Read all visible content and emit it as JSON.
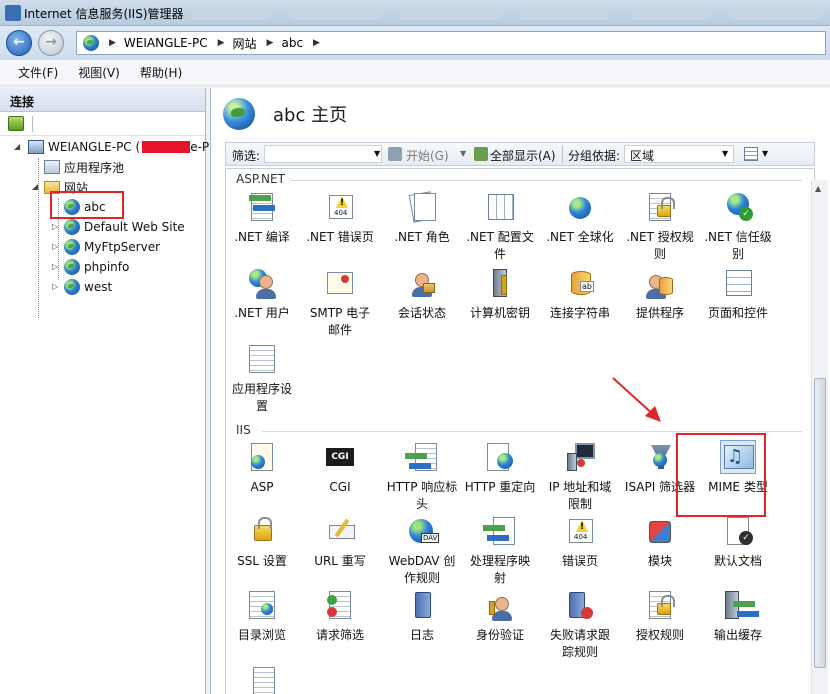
{
  "window": {
    "title": "Internet 信息服务(IIS)管理器"
  },
  "address": {
    "crumbs": [
      "WEIANGLE-PC",
      "网站",
      "abc"
    ]
  },
  "menu": {
    "items": [
      "文件(F)",
      "视图(V)",
      "帮助(H)"
    ]
  },
  "connections": {
    "header": "连接",
    "tree": {
      "root": "WEIANGLE-PC (",
      "root_suffix": "e-P",
      "app_pools": "应用程序池",
      "sites": "网站",
      "site_list": [
        "abc",
        "Default Web Site",
        "MyFtpServer",
        "phpinfo",
        "west"
      ]
    }
  },
  "page": {
    "title": "abc 主页",
    "filter": {
      "label": "筛选:",
      "go": "开始(G)",
      "show_all": "全部显示(A)",
      "group_by_label": "分组依据:",
      "group_by_value": "区域"
    }
  },
  "sections": {
    "aspnet": {
      "label": "ASP.NET",
      "tiles": [
        {
          "l1": ".NET 编译",
          "l2": ""
        },
        {
          "l1": ".NET 错误页",
          "l2": ""
        },
        {
          "l1": ".NET 角色",
          "l2": ""
        },
        {
          "l1": ".NET 配置文",
          "l2": "件"
        },
        {
          "l1": ".NET 全球化",
          "l2": ""
        },
        {
          "l1": ".NET 授权规",
          "l2": "则"
        },
        {
          "l1": ".NET 信任级",
          "l2": "别"
        },
        {
          "l1": ".NET 用户",
          "l2": ""
        },
        {
          "l1": "SMTP 电子",
          "l2": "邮件"
        },
        {
          "l1": "会话状态",
          "l2": ""
        },
        {
          "l1": "计算机密钥",
          "l2": ""
        },
        {
          "l1": "连接字符串",
          "l2": ""
        },
        {
          "l1": "提供程序",
          "l2": ""
        },
        {
          "l1": "页面和控件",
          "l2": ""
        },
        {
          "l1": "应用程序设",
          "l2": "置"
        }
      ]
    },
    "iis": {
      "label": "IIS",
      "tiles": [
        {
          "l1": "ASP",
          "l2": ""
        },
        {
          "l1": "CGI",
          "l2": ""
        },
        {
          "l1": "HTTP 响应标",
          "l2": "头"
        },
        {
          "l1": "HTTP 重定向",
          "l2": ""
        },
        {
          "l1": "IP 地址和域",
          "l2": "限制"
        },
        {
          "l1": "ISAPI 筛选器",
          "l2": ""
        },
        {
          "l1": "MIME 类型",
          "l2": ""
        },
        {
          "l1": "SSL 设置",
          "l2": ""
        },
        {
          "l1": "URL 重写",
          "l2": ""
        },
        {
          "l1": "WebDAV 创",
          "l2": "作规则"
        },
        {
          "l1": "处理程序映",
          "l2": "射"
        },
        {
          "l1": "错误页",
          "l2": ""
        },
        {
          "l1": "模块",
          "l2": ""
        },
        {
          "l1": "默认文档",
          "l2": ""
        },
        {
          "l1": "目录浏览",
          "l2": ""
        },
        {
          "l1": "请求筛选",
          "l2": ""
        },
        {
          "l1": "日志",
          "l2": ""
        },
        {
          "l1": "身份验证",
          "l2": ""
        },
        {
          "l1": "失败请求跟",
          "l2": "踪规则"
        },
        {
          "l1": "授权规则",
          "l2": ""
        },
        {
          "l1": "输出缓存",
          "l2": ""
        }
      ]
    }
  },
  "icon_text": {
    "cgi": "CGI",
    "error_page": "404"
  },
  "colors": {
    "annotation": "#e0242a",
    "accent": "#1f5fb8"
  }
}
